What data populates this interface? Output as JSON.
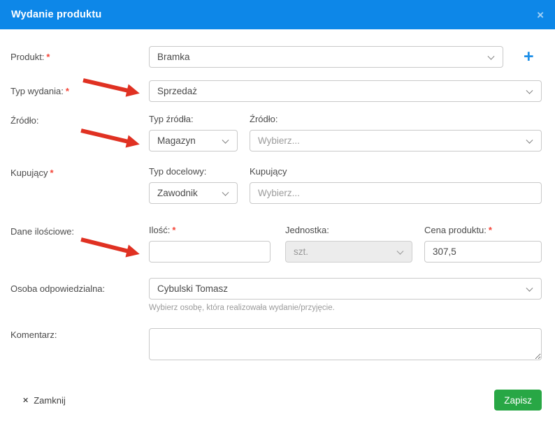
{
  "modal": {
    "title": "Wydanie produktu",
    "header_close": "×"
  },
  "form": {
    "produkt": {
      "label": "Produkt:",
      "required": "*",
      "value": "Bramka",
      "add_button": "+"
    },
    "typ_wydania": {
      "label": "Typ wydania:",
      "required": "*",
      "value": "Sprzedaż"
    },
    "zrodlo": {
      "label": "Źródło:",
      "typ_zrodla_label": "Typ źródła:",
      "typ_zrodla_value": "Magazyn",
      "zrodlo_label": "Źródło:",
      "zrodlo_placeholder": "Wybierz..."
    },
    "kupujacy": {
      "label": "Kupujący",
      "required": "*",
      "typ_docelowy_label": "Typ docelowy:",
      "typ_docelowy_value": "Zawodnik",
      "kupujacy_label": "Kupujący",
      "kupujacy_placeholder": "Wybierz..."
    },
    "dane_ilosciowe": {
      "label": "Dane ilościowe:",
      "ilosc_label": "Ilość:",
      "ilosc_required": "*",
      "ilosc_value": "",
      "jednostka_label": "Jednostka:",
      "jednostka_value": "szt.",
      "cena_label": "Cena produktu:",
      "cena_required": "*",
      "cena_value": "307,5"
    },
    "osoba": {
      "label": "Osoba odpowiedzialna:",
      "value": "Cybulski Tomasz",
      "helper": "Wybierz osobę, która realizowała wydanie/przyjęcie."
    },
    "komentarz": {
      "label": "Komentarz:",
      "value": ""
    }
  },
  "footer": {
    "close_icon": "✕",
    "close_label": "Zamknij",
    "save_label": "Zapisz"
  },
  "colors": {
    "header_blue": "#0d87e8",
    "accent_blue": "#1d8fe8",
    "save_green": "#28a745",
    "arrow_red": "#e03122",
    "required_red": "#f44336"
  }
}
